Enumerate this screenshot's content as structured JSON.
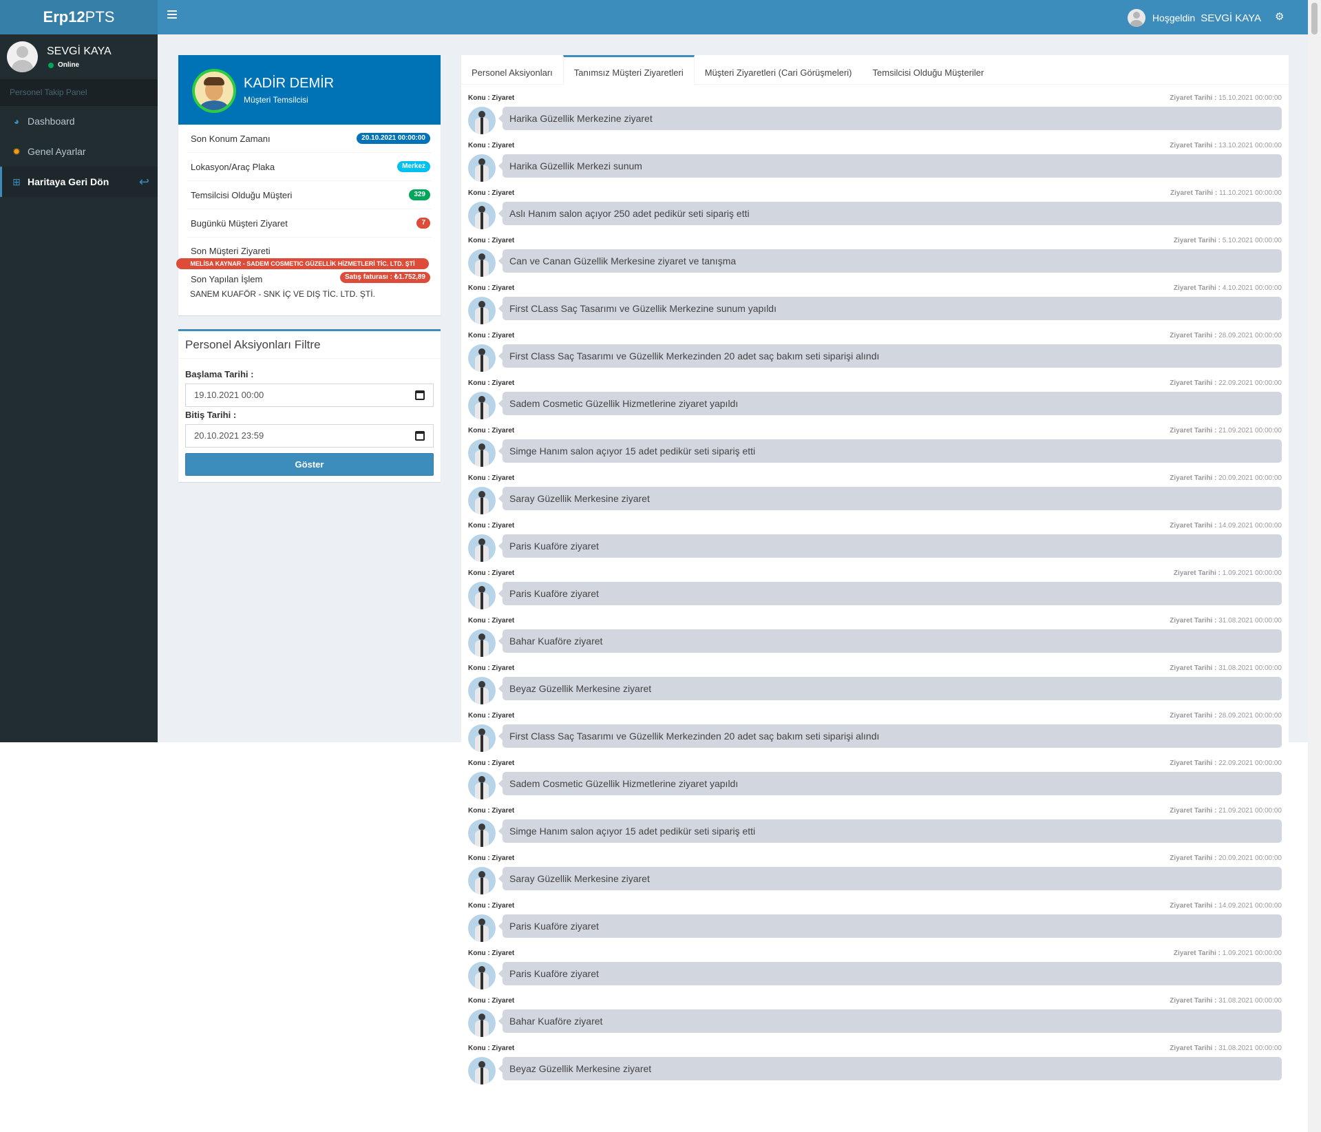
{
  "header": {
    "logo_bold": "Erp12",
    "logo_rest": "PTS",
    "greeting": "Hoşgeldin",
    "username": "SEVGİ KAYA"
  },
  "sidebar": {
    "user_name": "SEVGİ  KAYA",
    "status": "Online",
    "section_header": "Personel Takip Panel",
    "items": [
      {
        "label": "Dashboard",
        "icon": "dashboard-icon"
      },
      {
        "label": "Genel Ayarlar",
        "icon": "gear-icon"
      },
      {
        "label": "Haritaya Geri Dön",
        "icon": "map-icon"
      }
    ]
  },
  "profile": {
    "name": "KADİR DEMİR",
    "role": "Müşteri Temsilcisi",
    "rows": [
      {
        "label": "Son Konum Zamanı",
        "badge": "20.10.2021 00:00:00"
      },
      {
        "label": "Lokasyon/Araç Plaka",
        "badge": "Merkez"
      },
      {
        "label": "Temsilcisi Olduğu Müşteri",
        "badge": "329"
      },
      {
        "label": "Bugünkü Müşteri Ziyaret",
        "badge": "7"
      }
    ],
    "last_visit_label": "Son Müşteri Ziyareti",
    "last_visit_badge": "MELİSA KAYNAR - SADEM COSMETIC GÜZELLİK HİZMETLERİ TİC. LTD. ŞTİ",
    "last_action_label": "Son Yapılan İşlem",
    "last_action_badge": "Satış faturası : ₺1.752,89",
    "last_action_text": "SANEM KUAFÖR - SNK İÇ VE DIŞ TİC. LTD. ŞTİ."
  },
  "filter": {
    "title": "Personel Aksiyonları Filtre",
    "start_label": "Başlama Tarihi :",
    "start_value": "19.10.2021 00:00",
    "end_label": "Bitiş Tarihi :",
    "end_value": "20.10.2021 23:59",
    "button": "Göster"
  },
  "tabs": [
    "Personel Aksiyonları",
    "Tanımsız Müşteri Ziyaretleri",
    "Müşteri Ziyaretleri (Cari Görüşmeleri)",
    "Temsilcisi Olduğu Müşteriler"
  ],
  "active_tab": 1,
  "visit_subject_label": "Konu : Ziyaret",
  "visit_date_label": "Ziyaret Tarihi :",
  "visits": [
    {
      "text": "Harika Güzellik Merkezine ziyaret",
      "date": "15.10.2021 00:00:00"
    },
    {
      "text": "Harika Güzellik Merkezi sunum",
      "date": "13.10.2021 00:00:00"
    },
    {
      "text": "Aslı Hanım salon açıyor 250 adet pedikür seti sipariş etti",
      "date": "11.10.2021 00:00:00"
    },
    {
      "text": "Can ve Canan Güzellik Merkesine ziyaret ve tanışma",
      "date": "5.10.2021 00:00:00"
    },
    {
      "text": "First CLass Saç Tasarımı ve Güzellik Merkezine sunum yapıldı",
      "date": "4.10.2021 00:00:00"
    },
    {
      "text": "First Class Saç Tasarımı ve Güzellik Merkezinden 20 adet saç bakım seti siparişi alındı",
      "date": "28.09.2021 00:00:00"
    },
    {
      "text": "Sadem Cosmetic Güzellik Hizmetlerine ziyaret yapıldı",
      "date": "22.09.2021 00:00:00"
    },
    {
      "text": "Simge Hanım salon açıyor 15 adet pedikür seti sipariş etti",
      "date": "21.09.2021 00:00:00"
    },
    {
      "text": "Saray Güzellik Merkesine ziyaret",
      "date": "20.09.2021 00:00:00"
    },
    {
      "text": "Paris Kuaföre ziyaret",
      "date": "14.09.2021 00:00:00"
    },
    {
      "text": "Paris Kuaföre ziyaret",
      "date": "1.09.2021 00:00:00"
    },
    {
      "text": "Bahar Kuaföre  ziyaret",
      "date": "31.08.2021 00:00:00"
    },
    {
      "text": "Beyaz Güzellik Merkesine ziyaret",
      "date": "31.08.2021 00:00:00"
    },
    {
      "text": "First Class Saç Tasarımı ve Güzellik Merkezinden 20 adet saç bakım seti siparişi alındı",
      "date": "28.09.2021 00:00:00"
    },
    {
      "text": "Sadem Cosmetic Güzellik Hizmetlerine ziyaret yapıldı",
      "date": "22.09.2021 00:00:00"
    },
    {
      "text": "Simge Hanım salon açıyor 15 adet pedikür seti sipariş etti",
      "date": "21.09.2021 00:00:00"
    },
    {
      "text": "Saray Güzellik Merkesine ziyaret",
      "date": "20.09.2021 00:00:00"
    },
    {
      "text": "Paris Kuaföre ziyaret",
      "date": "14.09.2021 00:00:00"
    },
    {
      "text": "Paris Kuaföre ziyaret",
      "date": "1.09.2021 00:00:00"
    },
    {
      "text": "Bahar Kuaföre  ziyaret",
      "date": "31.08.2021 00:00:00"
    },
    {
      "text": "Beyaz Güzellik Merkesine ziyaret",
      "date": "31.08.2021 00:00:00"
    }
  ]
}
